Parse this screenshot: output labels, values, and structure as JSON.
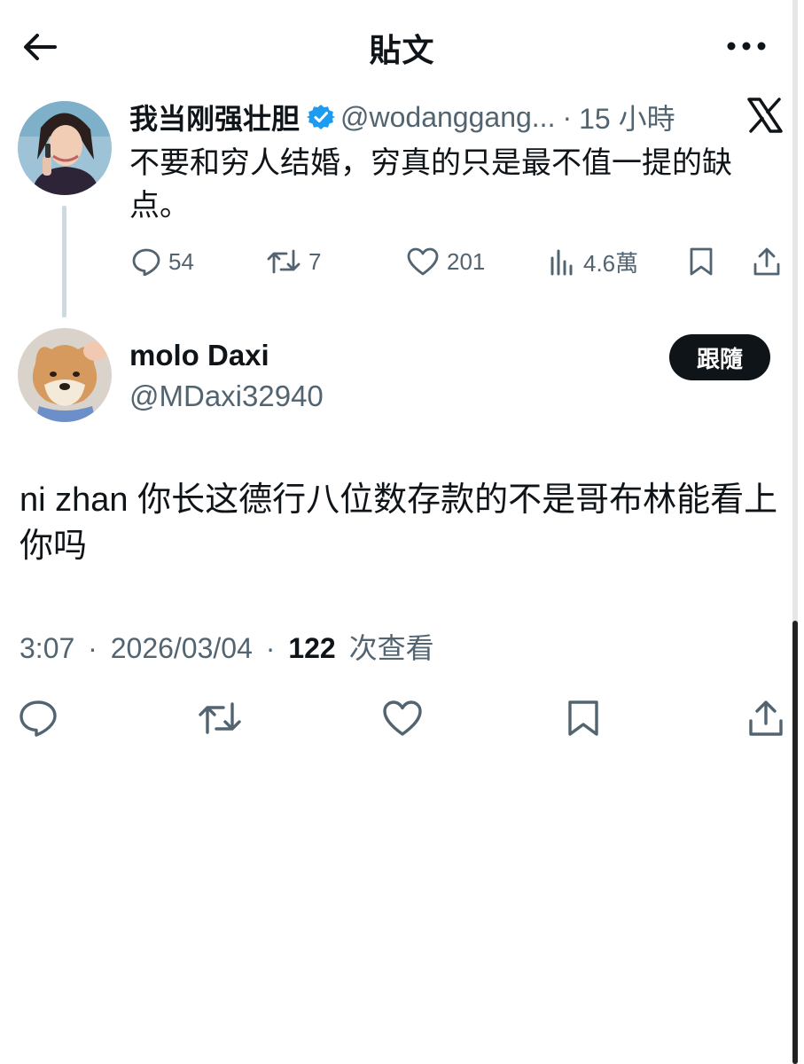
{
  "header": {
    "title": "貼文"
  },
  "original_post": {
    "author_name": "我当刚强壮胆",
    "handle": "@wodanggang...",
    "separator": "·",
    "time": "15 小時",
    "text": "不要和穷人结婚，穷真的只是最不值一提的缺点。",
    "stats": {
      "replies": "54",
      "reposts": "7",
      "likes": "201",
      "views": "4.6萬"
    }
  },
  "reply": {
    "author_name": "molo Daxi",
    "handle": "@MDaxi32940",
    "follow_label": "跟隨",
    "text": "ni zhan 你长这德行八位数存款的不是哥布林能看上你吗",
    "time": "3:07",
    "date": "2026/03/04",
    "separator": "·",
    "views": "122",
    "views_label": "次查看"
  },
  "colors": {
    "text": "#0f1419",
    "secondary": "#536471",
    "verified": "#1d9bf0",
    "follow_bg": "#0f1419"
  }
}
